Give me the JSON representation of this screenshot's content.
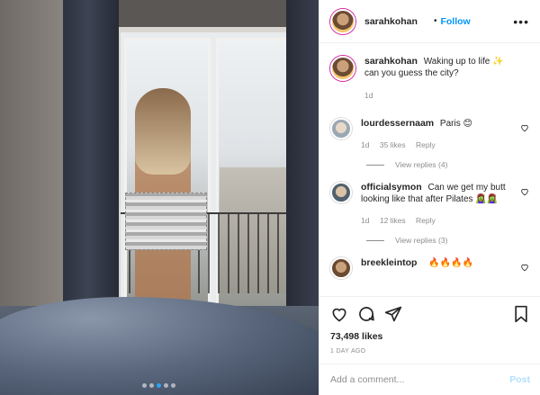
{
  "header": {
    "username": "sarahkohan",
    "separator": "•",
    "follow_label": "Follow",
    "more_icon": "more-options-icon"
  },
  "caption": {
    "username": "sarahkohan",
    "text": "Waking up to life ✨ can you guess the city?",
    "age": "1d"
  },
  "comments": [
    {
      "username": "lourdessernaam",
      "text": "Paris 😊",
      "age": "1d",
      "likes": "35 likes",
      "reply_label": "Reply",
      "view_replies": "View replies (4)"
    },
    {
      "username": "officialsymon",
      "text": "Can we get my butt looking like that after Pilates 🧟‍♀️🧟‍♀️",
      "age": "1d",
      "likes": "12 likes",
      "reply_label": "Reply",
      "view_replies": "View replies (3)"
    },
    {
      "username": "breekleintop",
      "text": "🔥🔥🔥🔥"
    }
  ],
  "actions": {
    "like_icon": "heart-icon",
    "comment_icon": "comment-icon",
    "share_icon": "share-icon",
    "save_icon": "bookmark-icon",
    "likes": "73,498 likes",
    "posted_ago": "1 DAY AGO"
  },
  "add_comment": {
    "placeholder": "Add a comment...",
    "post_label": "Post"
  },
  "carousel": {
    "slide_count": 5,
    "active_index": 2
  },
  "colors": {
    "accent": "#0095f6",
    "post_disabled": "#b2dffc",
    "muted": "#8e8e8e",
    "text": "#262626"
  }
}
